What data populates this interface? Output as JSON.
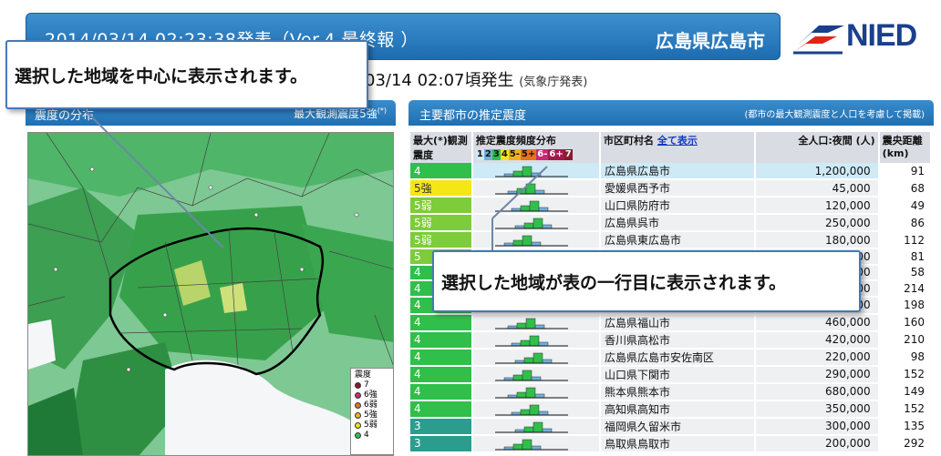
{
  "header": {
    "title": "2014/03/14 02:23:38発表（Ver.4 最終報 ）",
    "region": "広島県広島市"
  },
  "logo": {
    "text": "NIED"
  },
  "occurred": {
    "text": "03/14 02:07頃発生",
    "note": "(気象庁発表)"
  },
  "map_panel": {
    "title": "震度の分布",
    "max_label": "最大観測震度5強",
    "max_mark": "(*)",
    "legend_title": "震度",
    "legend": [
      {
        "label": "7",
        "color": "#8b1a2e"
      },
      {
        "label": "6強",
        "color": "#c8287a"
      },
      {
        "label": "6弱",
        "color": "#e8731c"
      },
      {
        "label": "5強",
        "color": "#f0b21a"
      },
      {
        "label": "5弱",
        "color": "#e8e21a"
      },
      {
        "label": "4",
        "color": "#2fbf4a"
      }
    ]
  },
  "table_panel": {
    "title": "主要都市の推定震度",
    "note": "(都市の最大観測震度と人口を考慮して掲載)",
    "columns": {
      "max_intensity": "最大(*)観測震度",
      "dist_title": "推定震度頻度分布",
      "scale": [
        "1",
        "2",
        "3",
        "4",
        "5-",
        "5+",
        "6-",
        "6+",
        "7"
      ],
      "city": "市区町村名",
      "show_all": "全て表示",
      "population": "全人口:夜間 (人)",
      "distance": "震央距離 (km)"
    },
    "rows": [
      {
        "intensity": "4",
        "city": "広島県広島市",
        "population": "1,200,000",
        "distance": "91",
        "cls": "c4",
        "sel": true
      },
      {
        "intensity": "5強",
        "city": "愛媛県西予市",
        "population": "45,000",
        "distance": "68",
        "cls": "c5s"
      },
      {
        "intensity": "5弱",
        "city": "山口県防府市",
        "population": "120,000",
        "distance": "49",
        "cls": "c5w"
      },
      {
        "intensity": "5弱",
        "city": "広島県呉市",
        "population": "250,000",
        "distance": "86",
        "cls": "c5w"
      },
      {
        "intensity": "5弱",
        "city": "広島県東広島市",
        "population": "180,000",
        "distance": "112",
        "cls": "c5w"
      },
      {
        "intensity": "5",
        "city": "",
        "population": "00",
        "distance": "81",
        "cls": "c5w"
      },
      {
        "intensity": "4",
        "city": "",
        "population": "00",
        "distance": "58",
        "cls": "c4"
      },
      {
        "intensity": "4",
        "city": "",
        "population": "00",
        "distance": "214",
        "cls": "c4"
      },
      {
        "intensity": "4",
        "city": "岡山県倉敷市",
        "population": "470,000",
        "distance": "198",
        "cls": "c4"
      },
      {
        "intensity": "4",
        "city": "広島県福山市",
        "population": "460,000",
        "distance": "160",
        "cls": "c4"
      },
      {
        "intensity": "4",
        "city": "香川県高松市",
        "population": "420,000",
        "distance": "210",
        "cls": "c4"
      },
      {
        "intensity": "4",
        "city": "広島県広島市安佐南区",
        "population": "220,000",
        "distance": "98",
        "cls": "c4"
      },
      {
        "intensity": "4",
        "city": "山口県下関市",
        "population": "290,000",
        "distance": "152",
        "cls": "c4"
      },
      {
        "intensity": "4",
        "city": "熊本県熊本市",
        "population": "680,000",
        "distance": "149",
        "cls": "c4"
      },
      {
        "intensity": "4",
        "city": "高知県高知市",
        "population": "350,000",
        "distance": "152",
        "cls": "c4"
      },
      {
        "intensity": "3",
        "city": "福岡県久留米市",
        "population": "300,000",
        "distance": "135",
        "cls": "c3"
      },
      {
        "intensity": "3",
        "city": "鳥取県鳥取市",
        "population": "200,000",
        "distance": "292",
        "cls": "c3"
      }
    ]
  },
  "callouts": {
    "map": "選択した地域を中心に表示されます。",
    "table": "選択した地域が表の一行目に表示されます。"
  }
}
